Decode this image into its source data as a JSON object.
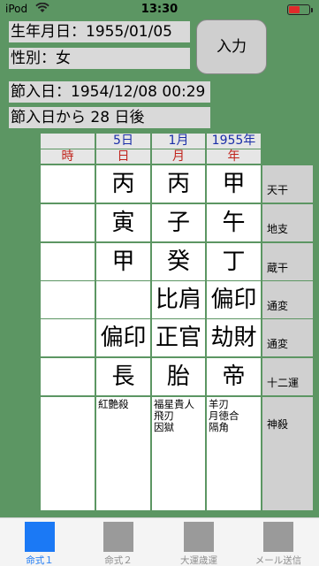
{
  "status_bar": {
    "carrier": "iPod",
    "time": "13:30",
    "battery_color": "#e02b2b"
  },
  "info": {
    "birth": "生年月日：1955/01/05",
    "sex": "性別：女",
    "setsu_date": "節入日：1954/12/08 00:29",
    "days_after": "節入日から 28 日後"
  },
  "input_button": "入力",
  "columns": {
    "top": [
      "5日",
      "1月",
      "1955年"
    ],
    "bottom": [
      "時",
      "日",
      "月",
      "年"
    ]
  },
  "rows": [
    {
      "label": "天干",
      "values": [
        "",
        "丙",
        "丙",
        "甲"
      ]
    },
    {
      "label": "地支",
      "values": [
        "",
        "寅",
        "子",
        "午"
      ]
    },
    {
      "label": "蔵干",
      "values": [
        "",
        "甲",
        "癸",
        "丁"
      ]
    },
    {
      "label": "通変",
      "values": [
        "",
        "",
        "比肩",
        "偏印"
      ]
    },
    {
      "label": "通変",
      "values": [
        "",
        "偏印",
        "正官",
        "劫財"
      ]
    },
    {
      "label": "十二運",
      "values": [
        "",
        "長",
        "胎",
        "帝"
      ]
    }
  ],
  "shinsatsu": {
    "label": "神殺",
    "values": [
      "",
      "紅艶殺",
      "福星貴人\n飛刃\n因獄",
      "羊刃\n月徳合\n隔角"
    ]
  },
  "tabs": [
    {
      "label": "命式１",
      "active": true
    },
    {
      "label": "命式２",
      "active": false
    },
    {
      "label": "大運歳運",
      "active": false
    },
    {
      "label": "メール送信",
      "active": false
    }
  ]
}
